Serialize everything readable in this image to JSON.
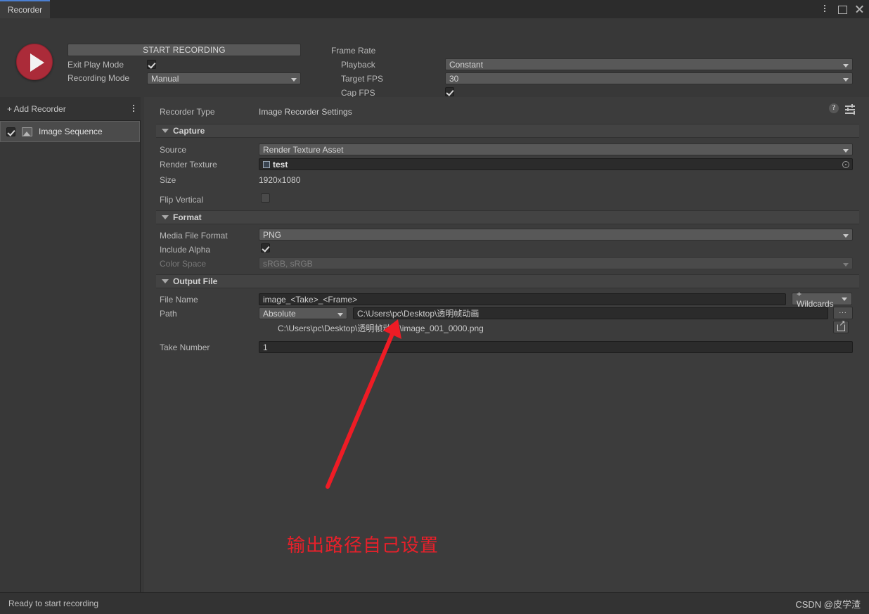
{
  "window": {
    "tab_label": "Recorder",
    "controls": {
      "menu": "kebab-menu-icon",
      "maximize": "maximize-icon",
      "close": "close-icon"
    }
  },
  "top": {
    "record_button": "record-button",
    "start_recording_label": "START RECORDING",
    "exit_play_mode_label": "Exit Play Mode",
    "exit_play_mode_checked": true,
    "recording_mode_label": "Recording Mode",
    "recording_mode_value": "Manual",
    "frame_rate_label": "Frame Rate",
    "playback_label": "Playback",
    "playback_value": "Constant",
    "target_fps_label": "Target FPS",
    "target_fps_value": "30",
    "cap_fps_label": "Cap FPS",
    "cap_fps_checked": true
  },
  "sidebar": {
    "add_recorder_label": "+ Add Recorder",
    "items": [
      {
        "label": "Image Sequence",
        "checked": true,
        "icon": "image-sequence-icon",
        "selected": true
      }
    ]
  },
  "settings": {
    "recorder_type_label": "Recorder Type",
    "recorder_type_value": "Image Recorder Settings",
    "help_icon": "help-icon",
    "preset_icon": "preset-icon",
    "capture": {
      "title": "Capture",
      "source_label": "Source",
      "source_value": "Render Texture Asset",
      "render_texture_label": "Render Texture",
      "render_texture_value": "test",
      "size_label": "Size",
      "size_value": "1920x1080",
      "flip_vertical_label": "Flip Vertical",
      "flip_vertical_checked": false
    },
    "format": {
      "title": "Format",
      "media_file_format_label": "Media File Format",
      "media_file_format_value": "PNG",
      "include_alpha_label": "Include Alpha",
      "include_alpha_checked": true,
      "color_space_label": "Color Space",
      "color_space_value": "sRGB, sRGB",
      "color_space_disabled": true
    },
    "output": {
      "title": "Output File",
      "file_name_label": "File Name",
      "file_name_value": "image_<Take>_<Frame>",
      "wildcards_label": "+ Wildcards",
      "path_label": "Path",
      "path_mode_value": "Absolute",
      "path_value": "C:\\Users\\pc\\Desktop\\透明帧动画",
      "browse_label": "...",
      "reveal_icon": "open-folder-icon",
      "resolved_path": "C:\\Users\\pc\\Desktop\\透明帧动画\\image_001_0000.png",
      "take_number_label": "Take Number",
      "take_number_value": "1"
    }
  },
  "annotation": {
    "text": "输出路径自己设置",
    "color": "#e8202a",
    "arrow_color": "#ee1c25"
  },
  "status": {
    "message": "Ready to start recording",
    "watermark": "CSDN @皮学渣"
  }
}
